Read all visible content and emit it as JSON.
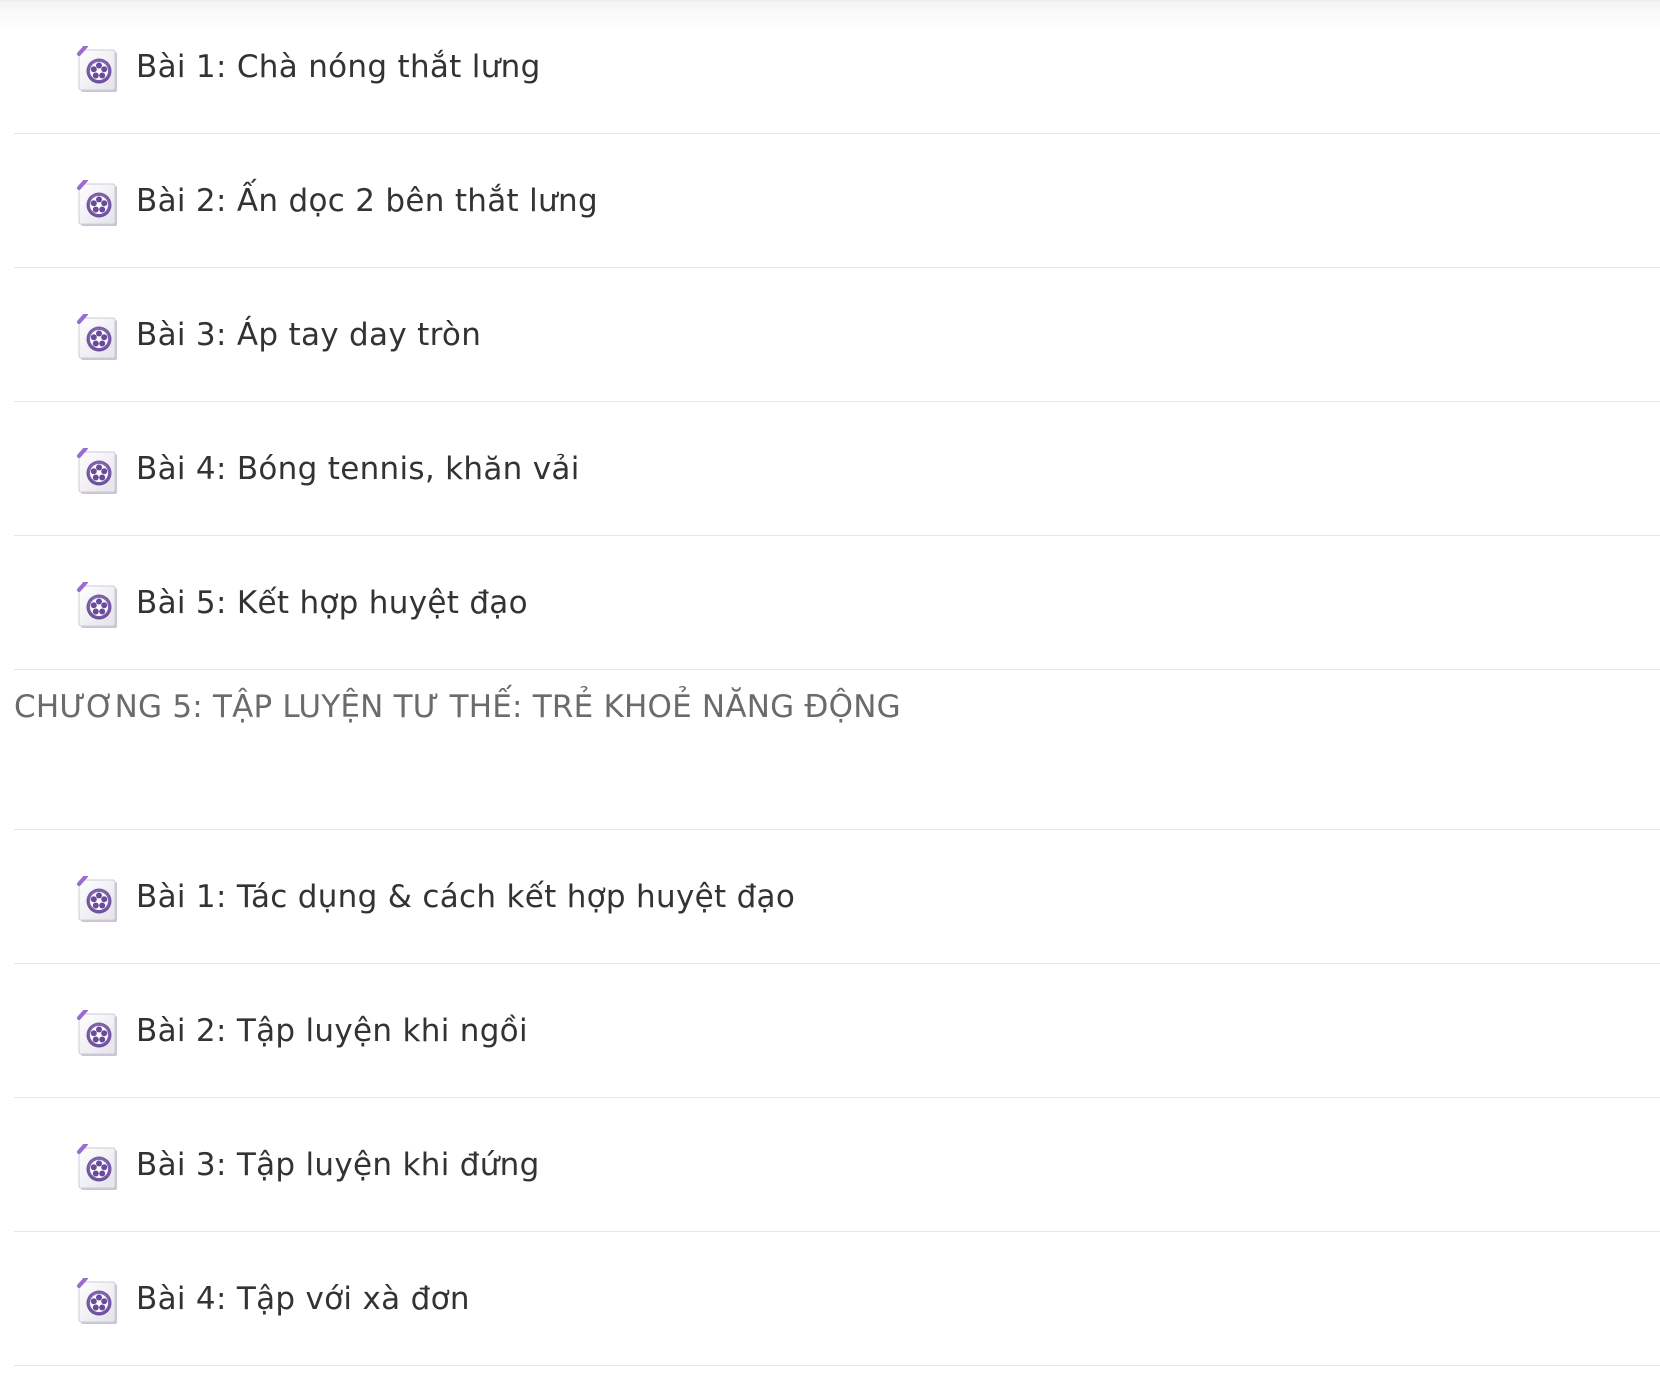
{
  "sections": [
    {
      "chapter_title": null,
      "lessons": [
        {
          "title": "Bài 1: Chà nóng thắt lưng",
          "icon": "video-icon"
        },
        {
          "title": "Bài 2: Ấn dọc 2 bên thắt lưng",
          "icon": "video-icon"
        },
        {
          "title": "Bài 3: Áp tay day tròn",
          "icon": "video-icon"
        },
        {
          "title": "Bài 4: Bóng tennis, khăn vải",
          "icon": "video-icon"
        },
        {
          "title": "Bài 5: Kết hợp huyệt đạo",
          "icon": "video-icon"
        }
      ]
    },
    {
      "chapter_title": "CHƯƠNG 5: TẬP LUYỆN TƯ THẾ: TRẺ KHOẺ NĂNG ĐỘNG",
      "lessons": [
        {
          "title": "Bài 1: Tác dụng & cách kết hợp huyệt đạo",
          "icon": "video-icon"
        },
        {
          "title": "Bài 2: Tập luyện khi ngồi",
          "icon": "video-icon"
        },
        {
          "title": "Bài 3: Tập luyện khi đứng",
          "icon": "video-icon"
        },
        {
          "title": "Bài 4: Tập với xà đơn",
          "icon": "video-icon"
        }
      ]
    }
  ],
  "colors": {
    "text": "#333333",
    "chapter_text": "#6b6b6b",
    "divider": "#e6e6e6",
    "icon_purple": "#6a4a9c",
    "icon_accent": "#9a6bd0"
  }
}
